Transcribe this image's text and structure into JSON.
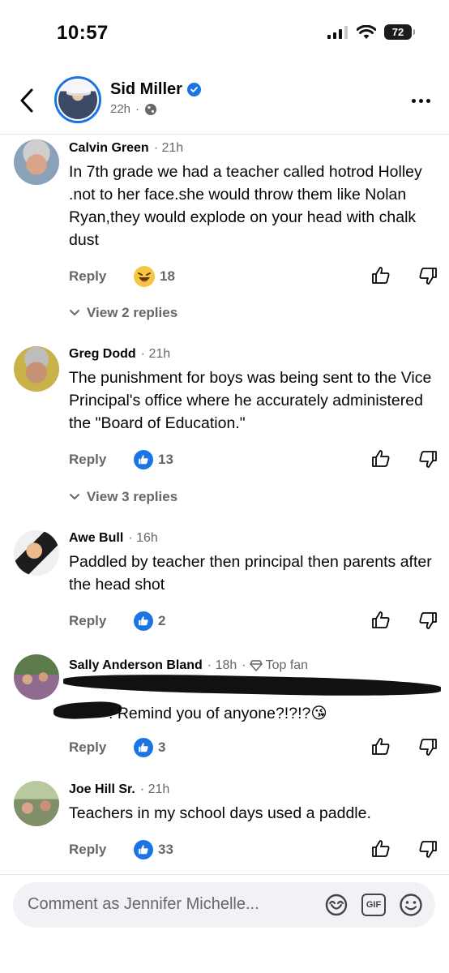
{
  "status_bar": {
    "time": "10:57",
    "battery": "72"
  },
  "header": {
    "name": "Sid Miller",
    "time": "22h",
    "separator": "·"
  },
  "comments": [
    {
      "author": "Calvin Green",
      "time": "21h",
      "text": "In 7th grade we had a teacher called hotrod Holley .not to her face.she would throw them like Nolan Ryan,they would explode on your head with chalk dust",
      "reply_label": "Reply",
      "reaction": "haha",
      "reaction_count": "18",
      "view_replies": "View 2 replies"
    },
    {
      "author": "Greg Dodd",
      "time": "21h",
      "text": "The punishment for boys was being sent to the Vice Principal's  office where he accurately administered the \"Board of Education.\"",
      "reply_label": "Reply",
      "reaction": "like",
      "reaction_count": "13",
      "view_replies": "View 3 replies"
    },
    {
      "author": "Awe Bull",
      "time": "16h",
      "text": "Paddled by teacher then principal then parents after the head shot",
      "reply_label": "Reply",
      "reaction": "like",
      "reaction_count": "2"
    },
    {
      "author": "Sally Anderson Bland",
      "time": "18h",
      "badge": "Top fan",
      "text": ": Remind you of anyone?!?!?😘",
      "reply_label": "Reply",
      "reaction": "like",
      "reaction_count": "3"
    },
    {
      "author": "Joe Hill Sr.",
      "time": "21h",
      "text": "Teachers in my school days used a paddle.",
      "reply_label": "Reply",
      "reaction": "like",
      "reaction_count": "33"
    }
  ],
  "composer": {
    "placeholder": "Comment as Jennifer Michelle..."
  },
  "colors": {
    "accent": "#1b74e4",
    "secondary_text": "#65676b",
    "haha": "#f7c544"
  }
}
